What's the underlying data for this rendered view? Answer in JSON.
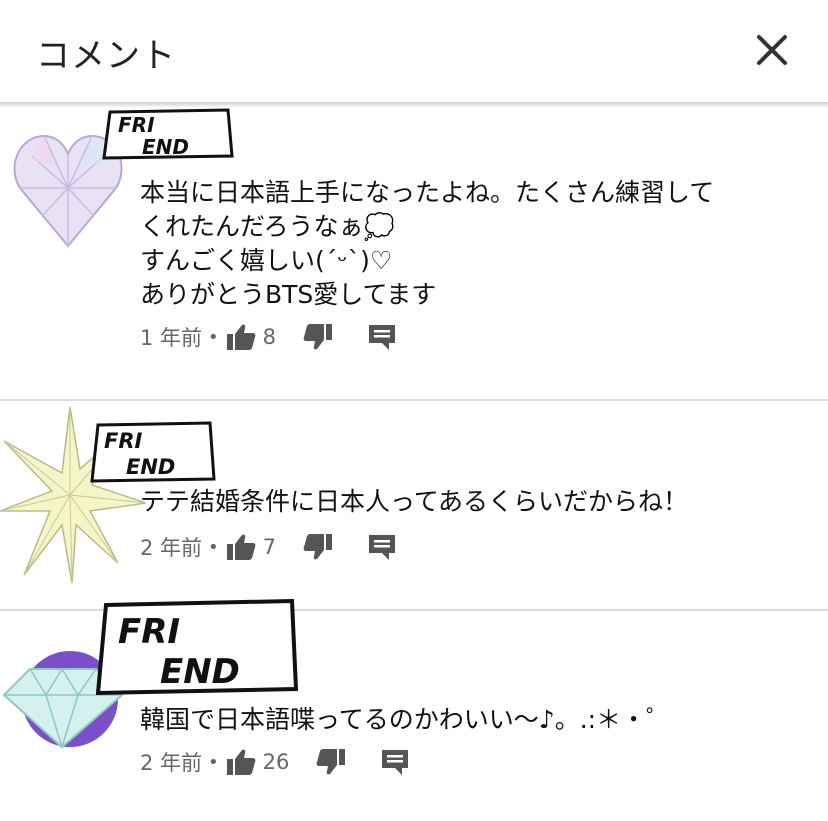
{
  "header": {
    "title": "コメント"
  },
  "badge_text": [
    "FRI",
    "END"
  ],
  "comments": [
    {
      "text": "本当に日本語上手になったよね。たくさん練習して\nくれたんだろうなぁ💭\nすんごく嬉しい(ˊᵕˋ)♡\nありがとうBTS愛してます",
      "time": "1 年前",
      "dot": "•",
      "likes": "8"
    },
    {
      "text": "テテ結婚条件に日本人ってあるくらいだからね！",
      "time": "2 年前",
      "dot": "•",
      "likes": "7"
    },
    {
      "text": "韓国で日本語喋ってるのかわいい〜♪。.:＊・゜",
      "time": "2 年前",
      "dot": "•",
      "likes": "26"
    }
  ],
  "colors": {
    "text": "#111111",
    "meta": "#666666",
    "icon": "#555555",
    "divider": "#dcdcdc",
    "avatar_purple": "#7b4fc9"
  }
}
